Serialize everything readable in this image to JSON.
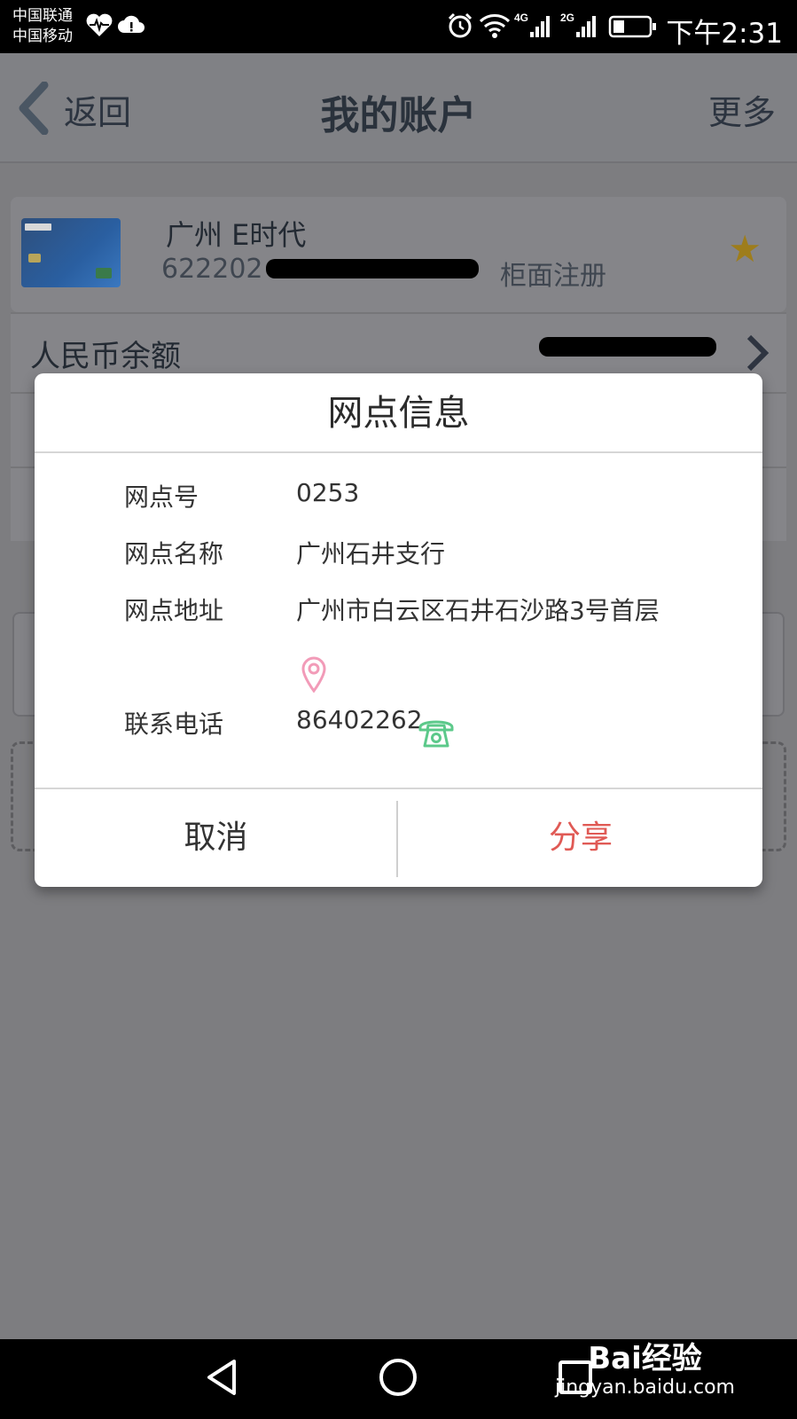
{
  "status_bar": {
    "carrier_1": "中国联通",
    "carrier_2": "中国移动",
    "network_1": "4G",
    "network_2": "2G",
    "time": "下午2:31",
    "icons": [
      "heartbeat-icon",
      "cloud-icon",
      "alarm-icon",
      "wifi-icon",
      "signal-icon",
      "battery-icon"
    ]
  },
  "header": {
    "back_label": "返回",
    "title": "我的账户",
    "more_label": "更多"
  },
  "account_card": {
    "name": "广州 E时代",
    "number_prefix": "622202",
    "registration": "柜面注册"
  },
  "balance": {
    "label": "人民币余额"
  },
  "dialog": {
    "title": "网点信息",
    "rows": [
      {
        "label": "网点号",
        "value": "0253"
      },
      {
        "label": "网点名称",
        "value": "广州石井支行"
      },
      {
        "label": "网点地址",
        "value": "广州市白云区石井石沙路3号首层"
      },
      {
        "label": "联系电话",
        "value": "86402262"
      }
    ],
    "cancel_label": "取消",
    "share_label": "分享"
  },
  "watermark": {
    "brand": "Bai经验",
    "url": "jingyan.baidu.com"
  },
  "colors": {
    "share_button": "#e05a55",
    "pin_icon": "#f29bb8",
    "phone_icon": "#5cc98a",
    "star": "#9e7d1b"
  }
}
